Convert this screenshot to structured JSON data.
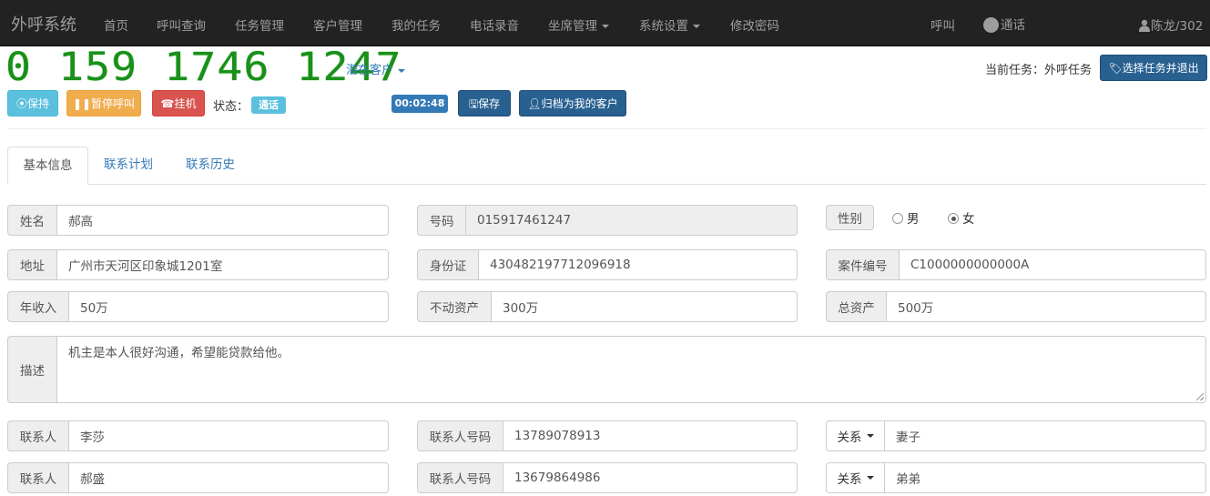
{
  "navbar": {
    "brand": "外呼系统",
    "items": [
      {
        "label": "首页"
      },
      {
        "label": "呼叫查询"
      },
      {
        "label": "任务管理"
      },
      {
        "label": "客户管理"
      },
      {
        "label": "我的任务"
      },
      {
        "label": "电话录音"
      },
      {
        "label": "坐席管理"
      },
      {
        "label": "系统设置"
      },
      {
        "label": "修改密码"
      }
    ],
    "call_label": "呼叫",
    "status_label": "通话",
    "user": "陈龙/302"
  },
  "call": {
    "number_display": "0 159 1746 1247",
    "customer_type": "潜在客户",
    "current_task_prefix": "当前任务：",
    "current_task": "外呼任务",
    "select_task_button": "选择任务并退出",
    "hold_button": "保持",
    "pause_button": "暂停呼叫",
    "hangup_button": "挂机",
    "status_label": "状态：",
    "status_value": "通话",
    "timer": "00:02:48",
    "save_button": "保存",
    "archive_button": "归档为我的客户"
  },
  "tabs": [
    {
      "label": "基本信息",
      "active": true
    },
    {
      "label": "联系计划",
      "active": false
    },
    {
      "label": "联系历史",
      "active": false
    }
  ],
  "form": {
    "name_label": "姓名",
    "name": "郝高",
    "phone_label": "号码",
    "phone": "015917461247",
    "gender_label": "性别",
    "gender_male": "男",
    "gender_female": "女",
    "gender_selected": "女",
    "address_label": "地址",
    "address": "广州市天河区印象城1201室",
    "id_label": "身份证",
    "id_number": "430482197712096918",
    "case_label": "案件编号",
    "case_number": "C1000000000000A",
    "income_label": "年收入",
    "income": "50万",
    "realestate_label": "不动资产",
    "realestate": "300万",
    "assets_label": "总资产",
    "assets": "500万",
    "desc_label": "描述",
    "description": "机主是本人很好沟通，希望能贷款给他。",
    "contacts": [
      {
        "label": "联系人",
        "name": "李莎",
        "phone_label": "联系人号码",
        "phone": "13789078913",
        "relation_label": "关系",
        "relation": "妻子"
      },
      {
        "label": "联系人",
        "name": "郝盛",
        "phone_label": "联系人号码",
        "phone": "13679864986",
        "relation_label": "关系",
        "relation": "弟弟"
      }
    ]
  },
  "colors": {
    "navbar_bg": "#222222",
    "led_green": "#1a8f1a",
    "primary": "#286090",
    "info": "#5bc0de",
    "warning": "#f0ad4e",
    "danger": "#d9534f"
  }
}
